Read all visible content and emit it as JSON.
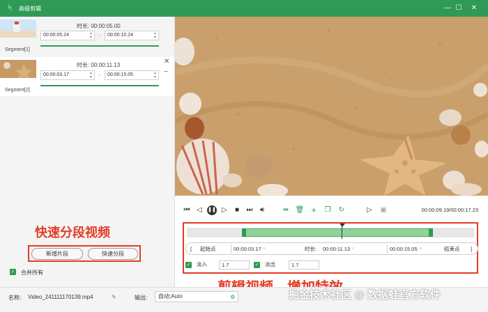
{
  "window": {
    "title": "高级剪辑"
  },
  "segments": [
    {
      "name": "Segment[1]",
      "duration_label": "时长:",
      "duration": "00:00:05.00",
      "start": "00:00:05.24",
      "end": "00:00:10.24"
    },
    {
      "name": "Segment[2]",
      "duration_label": "时长:",
      "duration": "00:00:11.13",
      "start": "00:00:03.17",
      "end": "00:00:15.05"
    }
  ],
  "left_panel": {
    "add_segment": "新增片段",
    "quick_split": "快速分段",
    "merge_all": "合并所有",
    "annotation": "快速分段视频"
  },
  "player": {
    "time": "00:00:09.19/00:00:17.23"
  },
  "editor": {
    "start_btn": "起始点",
    "start_time": "00:00:03.17",
    "duration_label": "时长:",
    "duration": "00:00:11.13",
    "end_time": "00:00:15.05",
    "end_btn": "结束点",
    "fade_in_label": "淡入",
    "fade_in": "1.7",
    "fade_out_label": "淡出",
    "fade_out": "1.7",
    "annotation": "剪辑视频，增加特效"
  },
  "bottom": {
    "name_label": "名称:",
    "name_value": "Video_241111170139.mp4",
    "output_label": "输出:",
    "output_value": "自动;Auto"
  },
  "watermark": {
    "text": "掘金技术社区 @ 数据蛙官方软件"
  },
  "colors": {
    "brand": "#2f9a55",
    "annotation": "#e33b26"
  }
}
